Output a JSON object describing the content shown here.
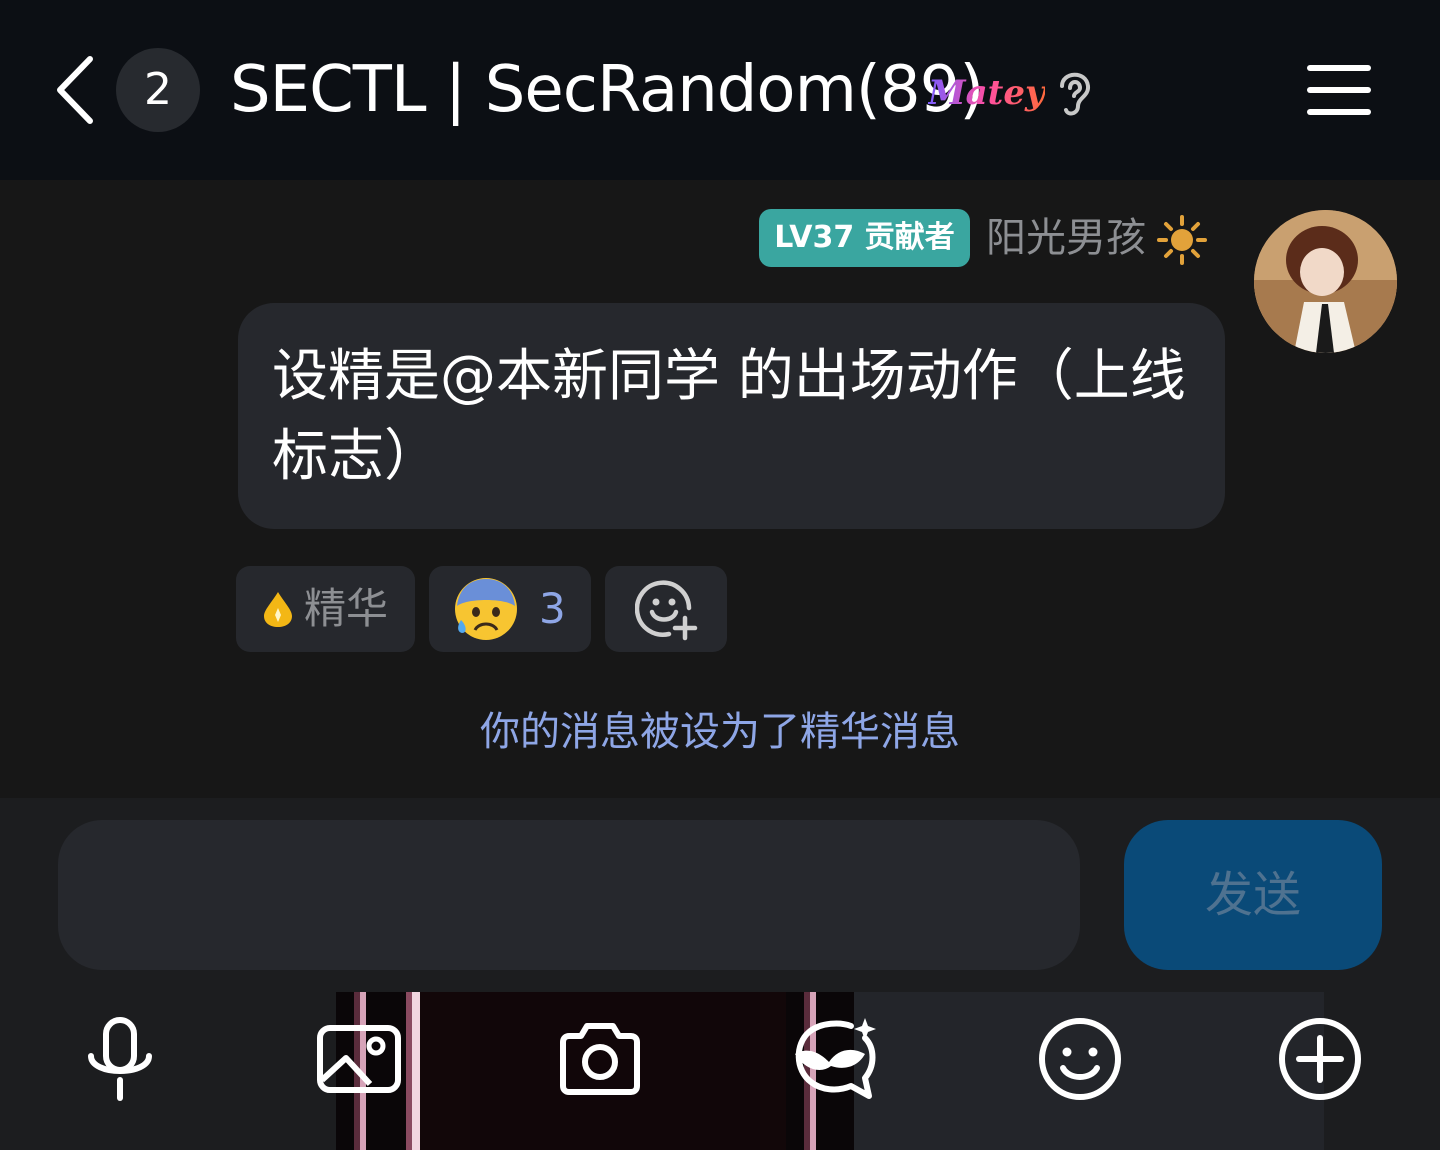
{
  "header": {
    "unread_count": "2",
    "title": "SECTL | SecRandom(89)",
    "matey_label": "Matey"
  },
  "message": {
    "badge": "LV37 贡献者",
    "username": "阳光男孩",
    "text": "设精是@本新同学 的出场动作（上线标志）"
  },
  "reactions": {
    "essence_label": "精华",
    "emoji_count": "3"
  },
  "notice": {
    "prefix": "你的消息被设为了",
    "link": "精华消息"
  },
  "composer": {
    "placeholder": "",
    "send_label": "发送"
  },
  "toolbar": {
    "icons": [
      "microphone-icon",
      "image-icon",
      "camera-icon",
      "mask-icon",
      "emoji-icon",
      "plus-icon"
    ]
  },
  "colors": {
    "header_bg": "#0c0f14",
    "chat_bg": "#171717",
    "bubble_bg": "#26282d",
    "badge_bg": "#3aa6a0",
    "link": "#8ea6e6",
    "send_bg": "#0a4a78"
  }
}
